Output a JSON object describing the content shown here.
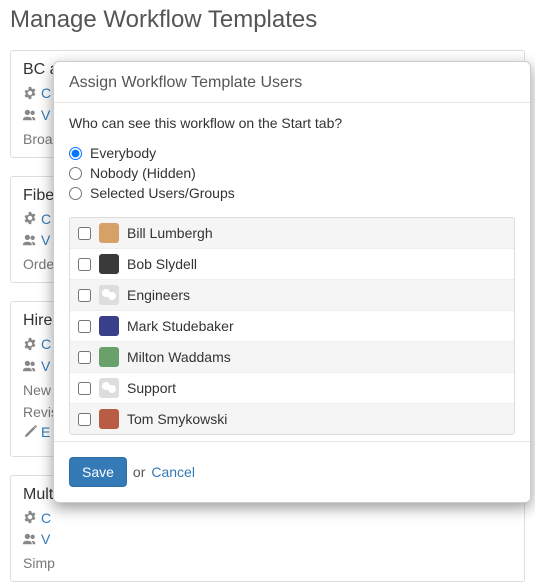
{
  "page": {
    "title": "Manage Workflow Templates"
  },
  "templates": [
    {
      "name": "BC a",
      "config": "C",
      "vis": "V",
      "desc": "Broa"
    },
    {
      "name": "Fibe",
      "config": "C",
      "vis": "V",
      "desc": "Orde"
    },
    {
      "name": "Hire",
      "config": "C",
      "vis": "V",
      "desc": "New",
      "revision": "Revis",
      "edit": "E"
    },
    {
      "name": "Mult",
      "config": "C",
      "vis": "V",
      "desc": "Simp"
    }
  ],
  "modal": {
    "title": "Assign Workflow Template Users",
    "question": "Who can see this workflow on the Start tab?",
    "options": {
      "everybody": "Everybody",
      "nobody": "Nobody (Hidden)",
      "selected": "Selected Users/Groups"
    },
    "selected_option": "everybody",
    "users": [
      {
        "name": "Bill Lumbergh",
        "type": "user",
        "avatar_bg": "#d6a066"
      },
      {
        "name": "Bob Slydell",
        "type": "user",
        "avatar_bg": "#3a3a3a"
      },
      {
        "name": "Engineers",
        "type": "group",
        "avatar_bg": "#dddddd"
      },
      {
        "name": "Mark Studebaker",
        "type": "user",
        "avatar_bg": "#3a3f8a"
      },
      {
        "name": "Milton Waddams",
        "type": "user",
        "avatar_bg": "#6aa06a"
      },
      {
        "name": "Support",
        "type": "group",
        "avatar_bg": "#dddddd"
      },
      {
        "name": "Tom Smykowski",
        "type": "user",
        "avatar_bg": "#b85c44"
      }
    ],
    "footer": {
      "save": "Save",
      "or": "or",
      "cancel": "Cancel"
    }
  }
}
